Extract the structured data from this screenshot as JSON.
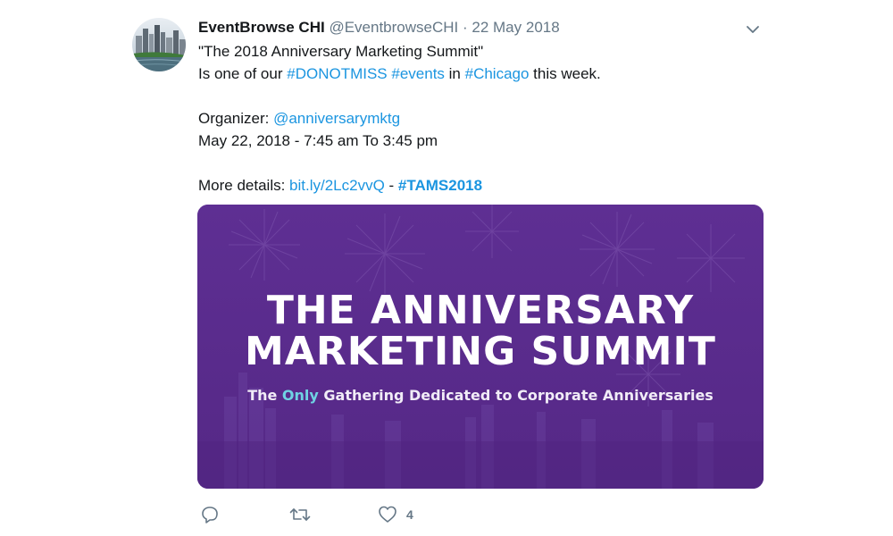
{
  "tweet": {
    "author_name": "EventBrowse CHI",
    "author_handle": "@EventbrowseCHI",
    "separator": "·",
    "date": "22 May 2018",
    "line1": "\"The 2018 Anniversary Marketing Summit\"",
    "line2_pre": "Is one of our ",
    "hashtag_donotmiss": "#DONOTMISS",
    "hashtag_events": "#events",
    "line2_in": "in",
    "hashtag_chicago": "#Chicago",
    "line2_post": " this week.",
    "organizer_label": "Organizer: ",
    "organizer_handle": "@anniversarymktg",
    "time_line": "May 22, 2018 - 7:45 am To 3:45 pm",
    "details_label": "More details: ",
    "details_link": "bit.ly/2Lc2vvQ",
    "details_sep": " - ",
    "hashtag_tams": "#TAMS2018"
  },
  "card": {
    "title_line1": "THE ANNIVERSARY",
    "title_line2": "MARKETING SUMMIT",
    "subtitle_pre": "The ",
    "subtitle_accent": "Only",
    "subtitle_post": " Gathering Dedicated to Corporate Anniversaries",
    "bg_color": "#5b2c8e",
    "accent_color": "#6fd3e3"
  },
  "actions": {
    "reply_icon": "reply-icon",
    "retweet_icon": "retweet-icon",
    "like_icon": "heart-icon",
    "like_count": "4"
  },
  "colors": {
    "link": "#1b95e0",
    "muted": "#657786",
    "text": "#14171a"
  }
}
